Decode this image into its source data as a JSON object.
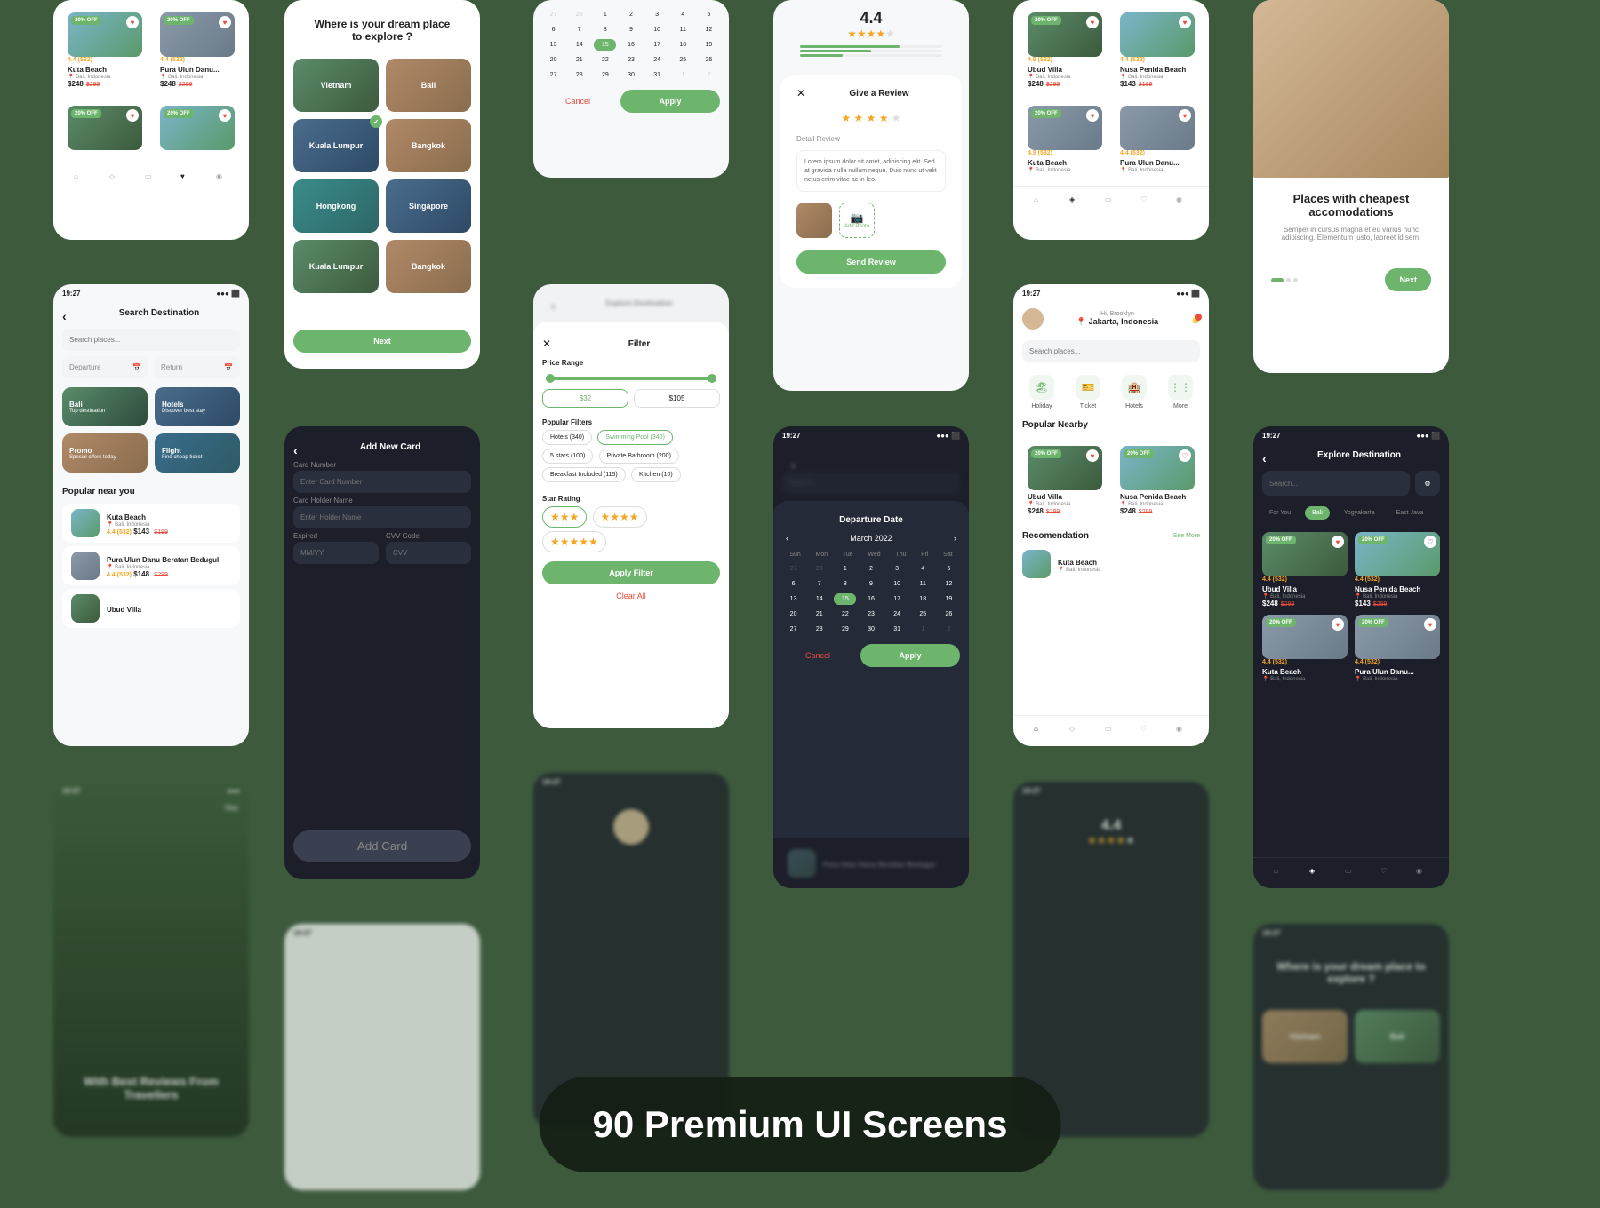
{
  "hero": "90 Premium UI Screens",
  "common": {
    "time": "19:27",
    "discount_badge": "20% OFF",
    "rating_text": "4.4 (532)",
    "rating_alt": "4.9 (532)",
    "loc_bali": "📍 Bali, Indonesia",
    "price": "$248",
    "price_old": "$299",
    "price_alt": "$143",
    "price_alt_old": "$189"
  },
  "places": {
    "kuta": "Kuta Beach",
    "pura": "Pura Ulun Danu...",
    "pura_full": "Pura Ulun Danu Beratan Bedugul",
    "ubud": "Ubud Villa",
    "nusa": "Nusa Penida Beach"
  },
  "dream": {
    "title": "Where is your dream place to explore ?",
    "dests": [
      "Vietnam",
      "Bali",
      "Kuala Lumpur",
      "Bangkok",
      "Hongkong",
      "Singapore",
      "Kuala Lumpur",
      "Bangkok"
    ],
    "next": "Next"
  },
  "calendar": {
    "days": [
      "Sun",
      "Mon",
      "Tue",
      "Wed",
      "Thu",
      "Fri",
      "Sat"
    ],
    "month": "March 2022",
    "departure_title": "Departure Date",
    "cancel": "Cancel",
    "apply": "Apply"
  },
  "review": {
    "title": "Give a Review",
    "detail_label": "Detail Review",
    "body": "Lorem ipsum dolor sit amet, adipiscing elit. Sed at gravida nulla nullam neque. Duis nunc ut velit netus enim vitae ac in leo.",
    "add_photo": "Add Photo",
    "send": "Send Review",
    "score": "4.4"
  },
  "search": {
    "title": "Search Destination",
    "placeholder": "Search places...",
    "departure": "Departure",
    "return": "Return",
    "cats": [
      {
        "t": "Bali",
        "s": "Top destination"
      },
      {
        "t": "Hotels",
        "s": "Discover best stay"
      },
      {
        "t": "Promo",
        "s": "Special offers today"
      },
      {
        "t": "Flight",
        "s": "Find cheap ticket"
      }
    ],
    "popular": "Popular near you"
  },
  "addcard": {
    "title": "Add New Card",
    "number_label": "Card Number",
    "number_ph": "Enter Card Number",
    "holder_label": "Card Holder Name",
    "holder_ph": "Enter Holder Name",
    "expired_label": "Expired",
    "expired_ph": "MM/YY",
    "cvv_label": "CVV Code",
    "cvv_ph": "CVV",
    "btn": "Add Card"
  },
  "filter": {
    "title": "Filter",
    "price_label": "Price Range",
    "min": "$32",
    "max": "$105",
    "popular_label": "Popular Filters",
    "chips": [
      "Hotels (340)",
      "Swimming Pool (340)",
      "5 stars (100)",
      "Private Bathroom (200)",
      "Breakfast Included (115)",
      "Kitchen (10)"
    ],
    "star_label": "Star Rating",
    "apply": "Apply Filter",
    "clear": "Clear All"
  },
  "home": {
    "greet": "Hi, Brooklyn",
    "loc": "📍 Jakarta, Indonesia",
    "cats": [
      "Holiday",
      "Ticket",
      "Hotels",
      "More"
    ],
    "popular": "Popular Nearby",
    "recom": "Recomendation",
    "seemore": "See More"
  },
  "explore": {
    "title": "Explore Destination",
    "search_ph": "Search...",
    "tabs": [
      "For You",
      "Bali",
      "Yogyakarta",
      "East Java"
    ]
  },
  "article": {
    "title": "Places with cheapest accomodations",
    "body": "Semper in cursus magna et eu varius nunc adipiscing. Elementum justo, laoreet id sem.",
    "next": "Next"
  },
  "onboard": {
    "skip": "Skip",
    "title": "With Best Reviews From Travellers"
  }
}
